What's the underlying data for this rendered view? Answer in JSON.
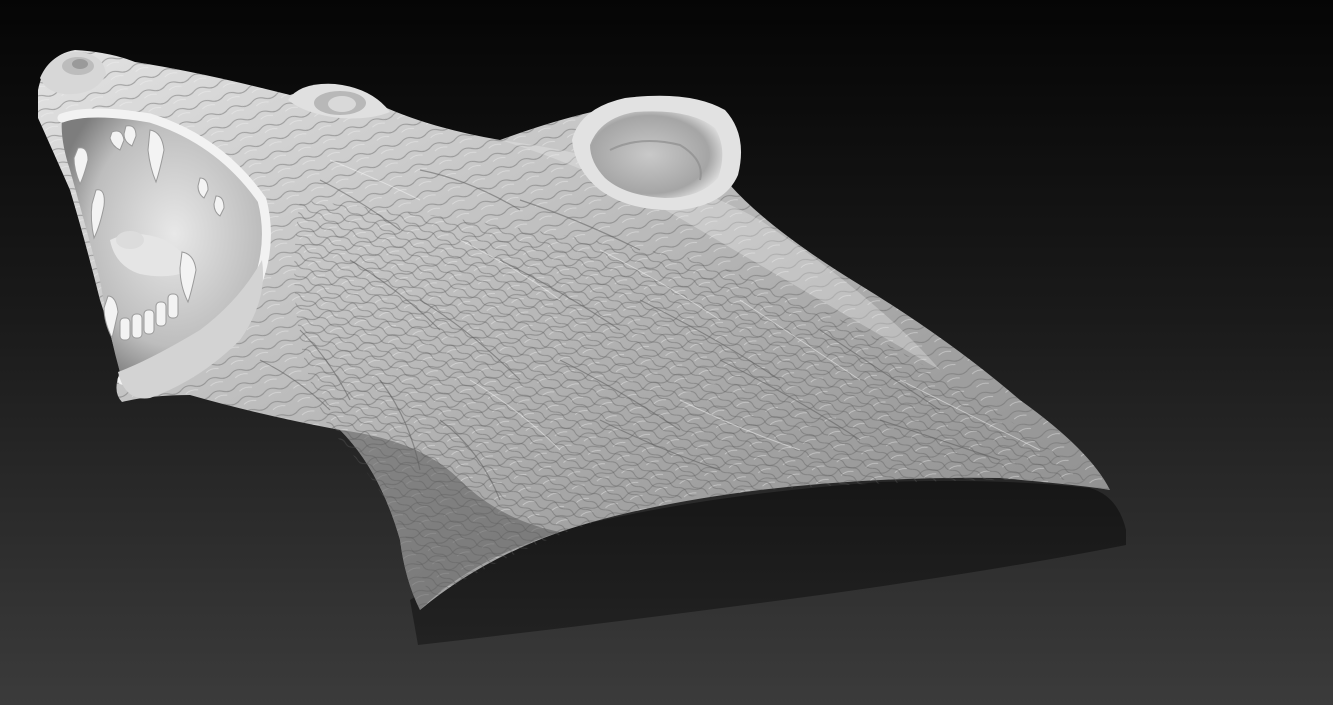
{
  "scene": {
    "subject": "sculpted-bear-head-bust",
    "render_style": "grayscale-matcap",
    "colors": {
      "background_top": "#060606",
      "background_bottom": "#3a3a3a",
      "clay_light": "#e6e6e6",
      "clay_mid": "#a9a9a9",
      "clay_dark": "#4a4a4a",
      "cut_base": "#1c1c1c",
      "mouth_inner": "#cfcfcf",
      "teeth": "#f2f2f2"
    }
  }
}
